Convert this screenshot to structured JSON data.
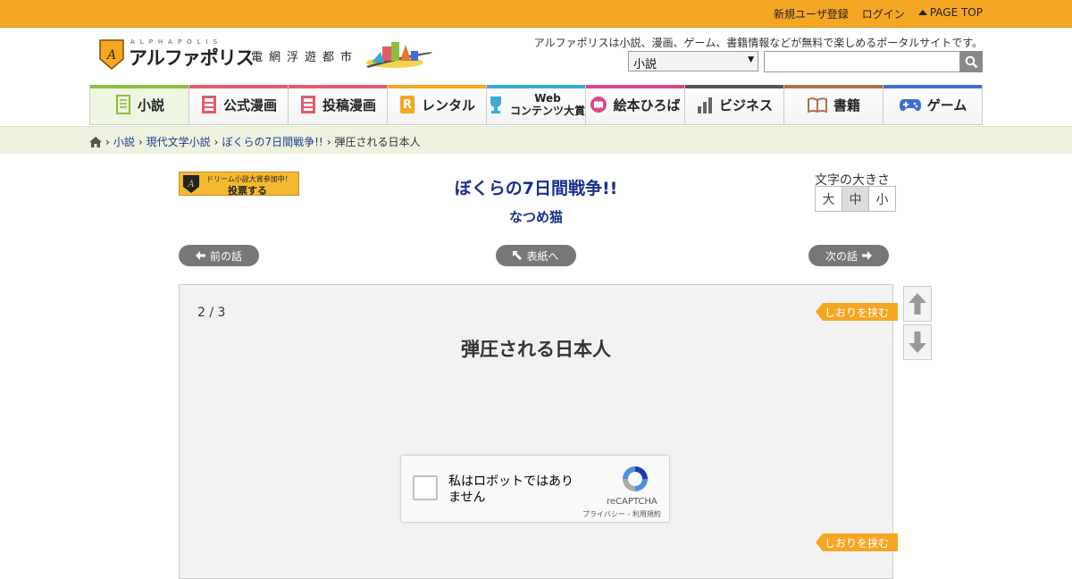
{
  "topbar": {
    "register": "新規ユーザ登録",
    "login": "ログイン",
    "page_top": "PAGE TOP"
  },
  "header": {
    "logo_alpha": "ALPHAPOLIS",
    "logo_text": "アルファポリス",
    "logo_sub": "電網浮遊都市",
    "tagline": "アルファポリスは小説、漫画、ゲーム、書籍情報などが無料で楽しめるポータルサイトです。",
    "search_category": "小説",
    "search_value": ""
  },
  "nav": [
    {
      "label": "小説",
      "icon": "novel-icon"
    },
    {
      "label": "公式漫画",
      "icon": "manga-icon"
    },
    {
      "label": "投稿漫画",
      "icon": "posted-manga-icon"
    },
    {
      "label": "レンタル",
      "icon": "rental-icon"
    },
    {
      "label_line1": "Web",
      "label_line2": "コンテンツ大賞",
      "icon": "trophy-icon"
    },
    {
      "label": "絵本ひろば",
      "icon": "picture-book-icon"
    },
    {
      "label": "ビジネス",
      "icon": "business-chart-icon"
    },
    {
      "label": "書籍",
      "icon": "book-icon"
    },
    {
      "label": "ゲーム",
      "icon": "gamepad-icon"
    }
  ],
  "nav_colors": [
    "#8bbf3f",
    "#e35b6a",
    "#e35b6a",
    "#f5a623",
    "#3aa9d6",
    "#d74a8a",
    "#555555",
    "#b06e4e",
    "#3f6fd1"
  ],
  "breadcrumb": [
    "小説",
    "現代文学小説",
    "ぼくらの7日間戦争!!",
    "弾圧される日本人"
  ],
  "vote_banner": {
    "line1": "ドリーム小説大賞参加中！",
    "line2": "投票する"
  },
  "novel": {
    "title": "ぼくらの7日間戦争!!",
    "author": "なつめ猫"
  },
  "font_size": {
    "label": "文字の大きさ",
    "large": "大",
    "medium": "中",
    "small": "小",
    "selected": "中"
  },
  "pager": {
    "prev": "前の話",
    "cover": "表紙へ",
    "next": "次の話"
  },
  "chapter": {
    "page": "2 / 3",
    "title": "弾圧される日本人"
  },
  "bookmark_label": "しおりを挟む",
  "recaptcha": {
    "label": "私はロボットではありません",
    "brand": "reCAPTCHA",
    "privacy": "プライバシー",
    "separator": " - ",
    "terms": "利用規約"
  }
}
